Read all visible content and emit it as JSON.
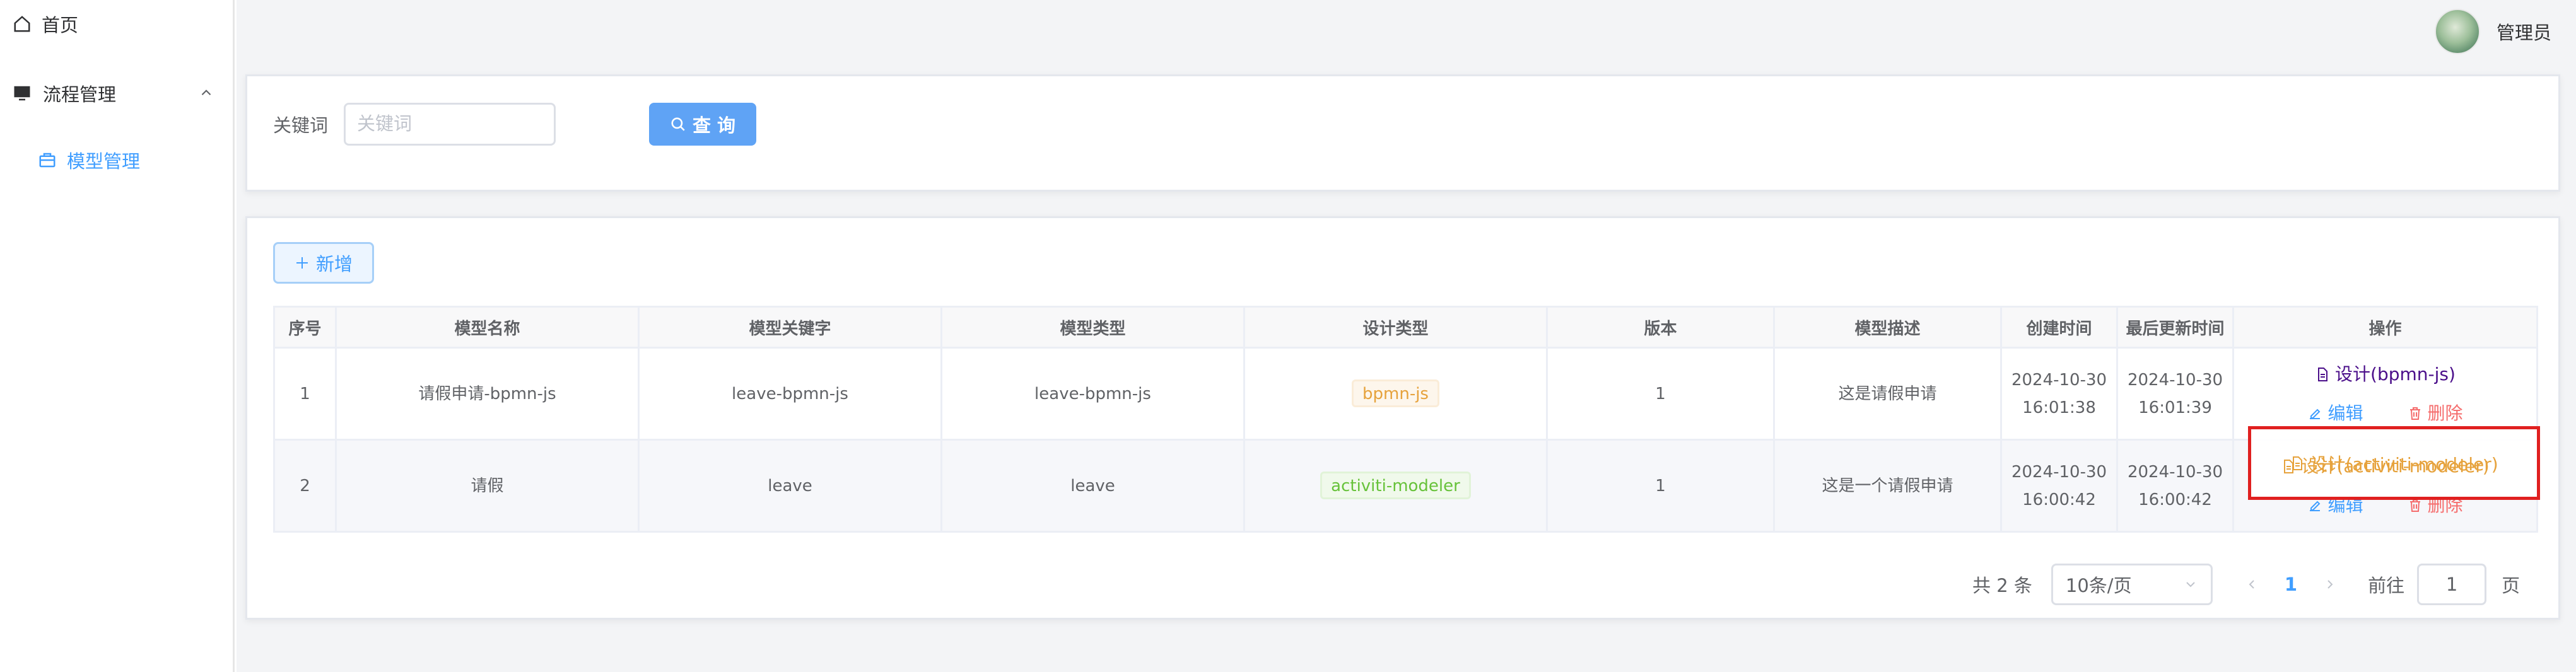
{
  "sidebar": {
    "home_label": "首页",
    "group_label": "流程管理",
    "sub_item_label": "模型管理"
  },
  "header": {
    "user_name": "管理员"
  },
  "search": {
    "keyword_label": "关键词",
    "keyword_placeholder": "关键词",
    "query_button": "查 询"
  },
  "toolbar": {
    "add_button": "新增"
  },
  "table": {
    "columns": [
      "序号",
      "模型名称",
      "模型关键字",
      "模型类型",
      "设计类型",
      "版本",
      "模型描述",
      "创建时间",
      "最后更新时间",
      "操作"
    ],
    "rows": [
      {
        "index": "1",
        "name": "请假申请-bpmn-js",
        "key": "leave-bpmn-js",
        "type": "leave-bpmn-js",
        "design_type": "bpmn-js",
        "version": "1",
        "description": "这是请假申请",
        "created_date": "2024-10-30",
        "created_time": "16:01:38",
        "updated_date": "2024-10-30",
        "updated_time": "16:01:39",
        "design_link": "设计(bpmn-js)",
        "edit_link": "编辑",
        "delete_link": "删除"
      },
      {
        "index": "2",
        "name": "请假",
        "key": "leave",
        "type": "leave",
        "design_type": "activiti-modeler",
        "version": "1",
        "description": "这是一个请假申请",
        "created_date": "2024-10-30",
        "created_time": "16:00:42",
        "updated_date": "2024-10-30",
        "updated_time": "16:00:42",
        "design_link": "设计(activiti-modeler)",
        "edit_link": "编辑",
        "delete_link": "删除"
      }
    ]
  },
  "pagination": {
    "total_text": "共 2 条",
    "page_size": "10条/页",
    "current_page": "1",
    "goto_label": "前往",
    "goto_value": "1",
    "page_suffix": "页"
  },
  "colors": {
    "primary": "#409eff",
    "danger": "#f56c6c",
    "warning": "#e6a23c",
    "success": "#67c23a",
    "design_link_purple": "#4b0f8a",
    "highlight_box": "#e02020"
  }
}
